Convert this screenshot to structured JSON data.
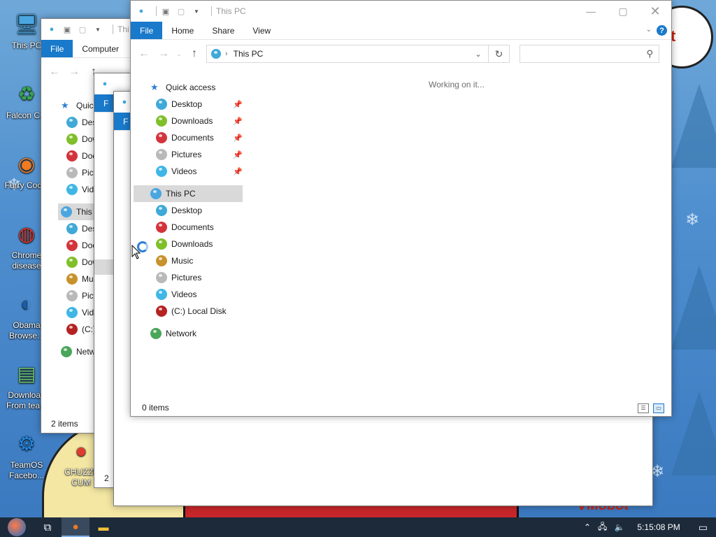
{
  "desktop": {
    "icons": [
      {
        "label": "This PC",
        "icon": "this-pc-icon",
        "color": "#4aa6e0"
      },
      {
        "label": "Falcon C...",
        "icon": "recycle-icon",
        "color": "#38a552"
      },
      {
        "label": "Furry Coc...",
        "icon": "firefox-icon",
        "color": "#f07b22"
      },
      {
        "label": "Chrome disease",
        "icon": "chrome-icon",
        "color": "#d6382a"
      },
      {
        "label": "Obama Browse...",
        "icon": "obama-logo-icon",
        "color": "#1a5da8"
      },
      {
        "label": "Download From tea...",
        "icon": "notepad-icon",
        "color": "#6cc06c"
      },
      {
        "label": "TeamOS Facebo...",
        "icon": "gear-icon",
        "color": "#1e88e5"
      },
      {
        "label": "CHUZZL CUM",
        "icon": "chuzzle-icon",
        "color": "#e03b30"
      }
    ],
    "cloud_text": "t",
    "corner_text": "VMobot"
  },
  "back_windows": {
    "win1": {
      "title": "Thi",
      "tab_file": "File",
      "tab_computer": "Computer",
      "nav": [
        "Quick",
        "Desk",
        "Dow",
        "Doc",
        "Pict",
        "Vide",
        "This P",
        "Desk",
        "Doc",
        "Dow",
        "Mus",
        "Pict",
        "Vide",
        "(C:)",
        "Netw"
      ],
      "status": "2 items"
    },
    "win2": {
      "tab_file": "F",
      "status": "2"
    },
    "win3": {
      "tab_file": "F"
    }
  },
  "explorer": {
    "title": "This PC",
    "ribbon_tabs": [
      "File",
      "Home",
      "Share",
      "View"
    ],
    "address": "This PC",
    "search_placeholder": "",
    "loading_text": "Working on it...",
    "quick_access_label": "Quick access",
    "quick_access": [
      {
        "label": "Desktop",
        "color": "#3fa9d8"
      },
      {
        "label": "Downloads",
        "color": "#7fbf2a"
      },
      {
        "label": "Documents",
        "color": "#d3343b"
      },
      {
        "label": "Pictures",
        "color": "#b9b9b9"
      },
      {
        "label": "Videos",
        "color": "#3fb6e6"
      }
    ],
    "this_pc_label": "This PC",
    "this_pc_items": [
      {
        "label": "Desktop",
        "color": "#3fa9d8"
      },
      {
        "label": "Documents",
        "color": "#d3343b"
      },
      {
        "label": "Downloads",
        "color": "#7fbf2a"
      },
      {
        "label": "Music",
        "color": "#c7922b"
      },
      {
        "label": "Pictures",
        "color": "#b9b9b9"
      },
      {
        "label": "Videos",
        "color": "#3fb6e6"
      },
      {
        "label": "(C:) Local Disk",
        "color": "#b52222"
      }
    ],
    "network_label": "Network",
    "status": "0 items"
  },
  "taskbar": {
    "time": "5:15:08 PM"
  }
}
